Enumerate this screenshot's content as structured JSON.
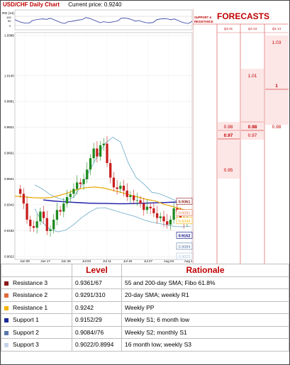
{
  "header": {
    "pair_title": "USD/CHF Daily Chart",
    "current_price": "Current price: 0.9240"
  },
  "rsi": {
    "label": "RSI (14)",
    "ticks": [
      "100",
      "50",
      "0"
    ]
  },
  "chart_data": {
    "type": "candlestick",
    "y_ticks": [
      "1.0389",
      "1.0140",
      "0.9981",
      "0.9821",
      "0.9661",
      "0.9501",
      "0.9342",
      "0.9182",
      "0.9022"
    ],
    "y_ticks_num": [
      1.0389,
      1.014,
      0.9981,
      0.9821,
      0.9661,
      0.9501,
      0.9342,
      0.9182,
      0.9022
    ],
    "ylim": [
      0.9022,
      1.0389
    ],
    "x_ticks": [
      "Jun 09",
      "Jun 17",
      "Jun 25",
      "Jul 03",
      "Jul 11",
      "Jul 19",
      "Jul 27",
      "Aug 04",
      "Aug 12"
    ],
    "closes": [
      0.941,
      0.935,
      0.925,
      0.921,
      0.92,
      0.924,
      0.93,
      0.926,
      0.918,
      0.919,
      0.925,
      0.931,
      0.93,
      0.935,
      0.939,
      0.941,
      0.944,
      0.948,
      0.947,
      0.95,
      0.956,
      0.963,
      0.969,
      0.964,
      0.971,
      0.972,
      0.96,
      0.951,
      0.945,
      0.944,
      0.946,
      0.943,
      0.939,
      0.94,
      0.937,
      0.937,
      0.935,
      0.931,
      0.933,
      0.932,
      0.929,
      0.926,
      0.927,
      0.924,
      0.922,
      0.925,
      0.932,
      0.93,
      0.925,
      0.923,
      0.924
    ],
    "sma200": [
      0.9372,
      0.9366,
      0.9362,
      0.9358,
      0.9355,
      0.9352,
      0.9351,
      0.935,
      0.9349,
      0.9349,
      0.935,
      0.9352,
      0.9354,
      0.9356,
      0.9358,
      0.936,
      0.9361
    ],
    "sma20": [
      0.9395,
      0.9392,
      0.9386,
      0.9384,
      0.9386,
      0.9399,
      0.9415,
      0.9435,
      0.9448,
      0.9452,
      0.9447,
      0.9433,
      0.942,
      0.9404,
      0.939,
      0.9375,
      0.9365,
      0.9345,
      0.933,
      0.9315,
      0.9302
    ],
    "bb_upper": [
      0.9465,
      0.944,
      0.9404,
      0.9382,
      0.937,
      0.939,
      0.946,
      0.955,
      0.964,
      0.972,
      0.976,
      0.973,
      0.96,
      0.951,
      0.947,
      0.942,
      0.941,
      0.939,
      0.937,
      0.935,
      0.935
    ],
    "bb_lower": [
      0.9318,
      0.9232,
      0.9188,
      0.9175,
      0.9186,
      0.922,
      0.9262,
      0.9296,
      0.9322,
      0.9324,
      0.931,
      0.9295,
      0.9282,
      0.9268,
      0.9248,
      0.9235,
      0.9226,
      0.9216,
      0.9208,
      0.9206,
      0.921
    ],
    "level_labels": [
      "0.9361",
      "0.9291",
      "0.9242",
      "0.9152",
      "0.9084",
      "0.9022"
    ],
    "level_values": [
      0.9361,
      0.9291,
      0.9242,
      0.9152,
      0.9084,
      0.9022
    ],
    "level_colors": [
      "#8b1a1a",
      "#e06c3c",
      "#f4b400",
      "#000080",
      "#5a78a8",
      "#a8c0dc"
    ]
  },
  "forecasts": {
    "title": "FORECASTS",
    "sr_label_1": "SUPPORT &",
    "sr_label_2": "RESISTANCE",
    "columns": [
      "Q3 31",
      "Q4 13",
      "Q1 14"
    ],
    "col1": {
      "f1": "0.98",
      "f2": "0.97",
      "f3": "0.95"
    },
    "col2": {
      "f1": "1.01",
      "f2": "0.98",
      "f3": "0.97"
    },
    "col3": {
      "f1": "1.03",
      "f2": "1",
      "f3": "0.98"
    }
  },
  "levels_table": {
    "headers": [
      "",
      "Level",
      "Rationale"
    ],
    "rows": [
      {
        "name": "Resistance 3",
        "level": "0.9361/67",
        "rationale": "55 and 200-day SMA; Fibo 61.8%",
        "color": "#8b1a1a"
      },
      {
        "name": "Resistance 2",
        "level": "0.9291/310",
        "rationale": "20-day SMA; weekly R1",
        "color": "#e06c3c"
      },
      {
        "name": "Resistance 1",
        "level": "0.9242",
        "rationale": "Weekly PP",
        "color": "#f4b400"
      },
      {
        "name": "Support 1",
        "level": "0.9152/29",
        "rationale": "Weekly S1; 6 month low",
        "color": "#1a2a9a"
      },
      {
        "name": "Support 2",
        "level": "0.9084//76",
        "rationale": "Weekly S2; monthly S1",
        "color": "#5a78a8"
      },
      {
        "name": "Support 3",
        "level": "0.9022/0.8994",
        "rationale": "16 month low; weekly S3",
        "color": "#c4d4ea"
      }
    ]
  }
}
